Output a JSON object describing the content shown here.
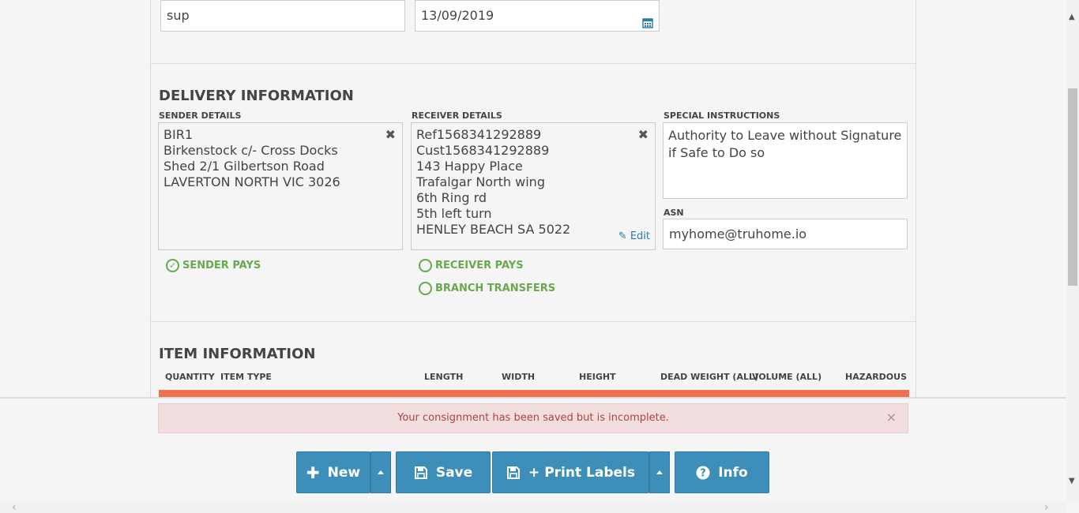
{
  "top_fields": {
    "reference_value": "sup",
    "date_value": "13/09/2019",
    "calendar_icon": "calendar-icon"
  },
  "delivery": {
    "title": "DELIVERY INFORMATION",
    "sender_label": "SENDER DETAILS",
    "sender_lines": [
      "BIR1",
      "Birkenstock c/- Cross Docks",
      "Shed 2/1 Gilbertson Road",
      "LAVERTON NORTH VIC 3026"
    ],
    "receiver_label": "RECEIVER DETAILS",
    "receiver_lines": [
      "Ref1568341292889",
      "Cust1568341292889",
      "143 Happy Place",
      "Trafalgar North wing",
      "6th Ring rd",
      "5th left turn",
      "HENLEY BEACH SA 5022"
    ],
    "edit_label": "Edit",
    "special_label": "SPECIAL INSTRUCTIONS",
    "special_value": "Authority to Leave without Signature if Safe to Do so",
    "asn_label": "ASN",
    "asn_value": "myhome@truhome.io",
    "sender_pays": "SENDER PAYS",
    "receiver_pays": "RECEIVER PAYS",
    "branch_transfers": "BRANCH TRANSFERS"
  },
  "items": {
    "title": "ITEM INFORMATION",
    "columns": [
      "QUANTITY",
      "ITEM TYPE",
      "LENGTH",
      "WIDTH",
      "HEIGHT",
      "DEAD WEIGHT (ALL)",
      "VOLUME (ALL)",
      "HAZARDOUS"
    ]
  },
  "alert": {
    "message": "Your consignment has been saved but is incomplete.",
    "close": "×"
  },
  "buttons": {
    "new": "New",
    "save": "Save",
    "print_labels": "+ Print Labels",
    "info": "Info"
  },
  "colors": {
    "accent": "#3d8eb9",
    "green": "#6aa84f",
    "orange": "#ef7150",
    "alert_bg": "#f2dede",
    "alert_text": "#a94442"
  }
}
